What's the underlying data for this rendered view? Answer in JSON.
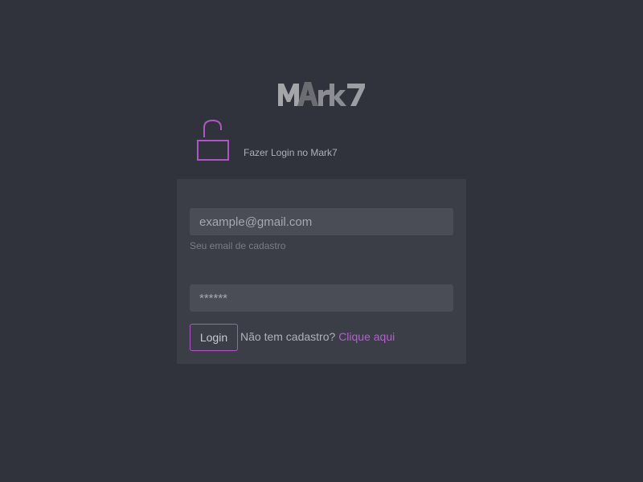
{
  "header": {
    "logo_text": "MArk7",
    "subtitle": "Fazer Login no Mark7",
    "lock_icon": "unlocked-padlock-icon"
  },
  "login_form": {
    "email": {
      "placeholder": "example@gmail.com",
      "value": "",
      "helper_text": "Seu email de cadastro"
    },
    "password": {
      "placeholder": "******",
      "value": ""
    },
    "login_button_label": "Login",
    "signup_prompt": "Não tem cadastro?",
    "signup_link_label": "Clique aqui"
  },
  "colors": {
    "background": "#31333c",
    "card": "#3b3d47",
    "input": "#4a4c56",
    "accent": "#b056c4"
  }
}
